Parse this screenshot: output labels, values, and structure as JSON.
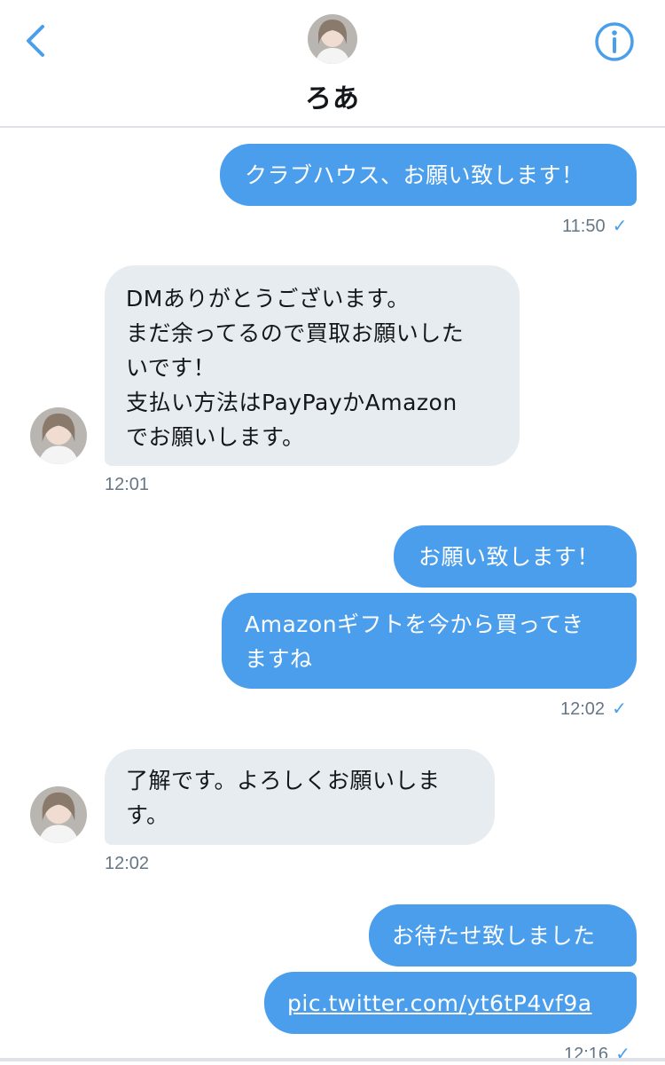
{
  "header": {
    "title": "ろあ",
    "back_icon": "chevron-left-icon",
    "info_icon": "info-icon",
    "accent": "#4a9eec"
  },
  "messages": [
    {
      "direction": "out",
      "lines": [
        "クラブハウス、お願い致します！"
      ]
    },
    {
      "time": "11:50",
      "status_icon": "check-icon"
    },
    {
      "direction": "in",
      "lines": [
        "DMありがとうございます。",
        "まだ余ってるので買取お願いした",
        "いです！",
        "支払い方法はPayPayかAmazon",
        "でお願いします。"
      ]
    },
    {
      "time": "12:01"
    },
    {
      "direction": "out",
      "lines": [
        "お願い致します！"
      ]
    },
    {
      "direction": "out",
      "lines": [
        "Amazonギフトを今から買ってき",
        "ますね"
      ]
    },
    {
      "time": "12:02",
      "status_icon": "check-icon"
    },
    {
      "direction": "in",
      "lines": [
        "了解です。よろしくお願いしま",
        "す。"
      ]
    },
    {
      "time": "12:02"
    },
    {
      "direction": "out",
      "lines": [
        "お待たせ致しました"
      ]
    },
    {
      "direction": "out",
      "link": "pic.twitter.com/yt6tP4vf9a"
    },
    {
      "time": "12:16",
      "status_icon": "check-icon"
    }
  ],
  "colors": {
    "outgoing_bubble": "#4a9eec",
    "incoming_bubble": "#e6ecf0",
    "timestamp": "#657786"
  }
}
